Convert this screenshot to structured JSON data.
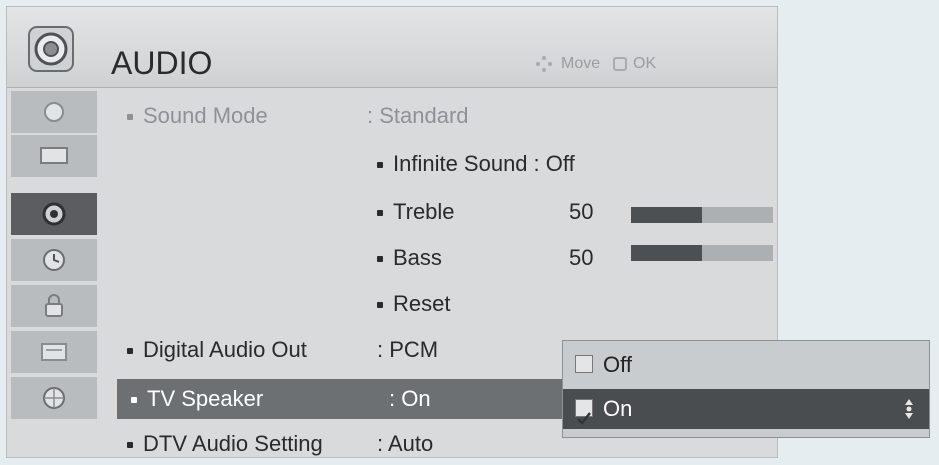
{
  "header": {
    "title": "AUDIO",
    "move_label": "Move",
    "ok_label": "OK"
  },
  "sidebar": {
    "items": [
      {
        "icon": "picture-menu-icon"
      },
      {
        "icon": "screen-menu-icon"
      },
      {
        "icon": "audio-menu-icon",
        "active": true
      },
      {
        "icon": "time-menu-icon"
      },
      {
        "icon": "lock-menu-icon"
      },
      {
        "icon": "option-menu-icon"
      },
      {
        "icon": "network-menu-icon"
      }
    ]
  },
  "menu": {
    "sound_mode": {
      "label": "Sound Mode",
      "value": ": Standard"
    },
    "infinite_sound": {
      "label": "Infinite Sound",
      "value": ": Off"
    },
    "treble": {
      "label": "Treble",
      "value": "50",
      "level": 0.5
    },
    "bass": {
      "label": "Bass",
      "value": "50",
      "level": 0.5
    },
    "reset": {
      "label": "Reset"
    },
    "digital_audio_out": {
      "label": "Digital Audio Out",
      "value": ": PCM"
    },
    "tv_speaker": {
      "label": "TV Speaker",
      "value": ": On"
    },
    "dtv_audio": {
      "label": "DTV Audio Setting",
      "value": ": Auto"
    }
  },
  "popup": {
    "options": [
      {
        "label": "Off",
        "checked": false
      },
      {
        "label": "On",
        "checked": true
      }
    ]
  },
  "colors": {
    "background": "#e6edf0",
    "panel": "#d9dadb",
    "selected": "#6d7073",
    "bar_fill": "#4d5053"
  }
}
